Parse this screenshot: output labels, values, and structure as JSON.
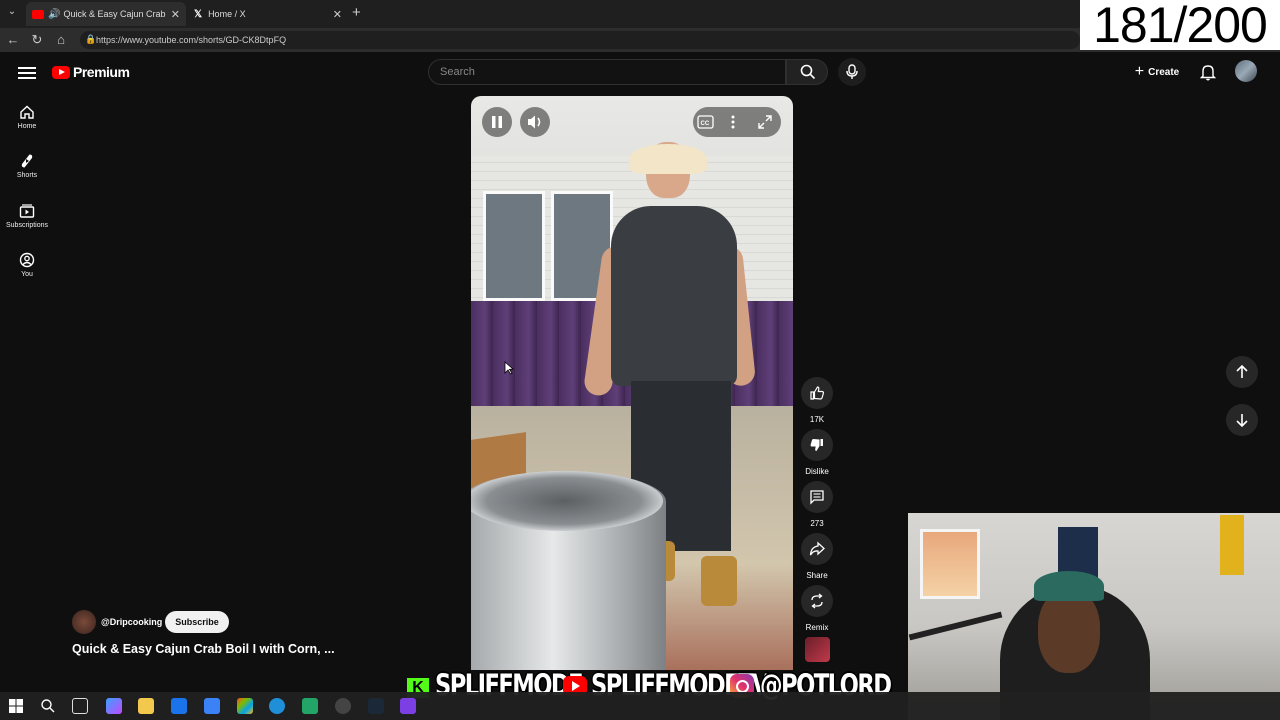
{
  "browser": {
    "tabs": [
      {
        "title": "Quick & Easy Cajun Crab Boil",
        "active": true,
        "icon": "youtube-icon"
      },
      {
        "title": "Home / X",
        "active": false,
        "icon": "x-logo-icon"
      }
    ],
    "url": "https://www.youtube.com/shorts/GD-CK8DtpFQ"
  },
  "counter": "181/200",
  "header": {
    "logo_text": "Premium",
    "search_placeholder": "Search",
    "create_label": "Create"
  },
  "sidebar": {
    "items": [
      {
        "label": "Home",
        "icon": "home-icon"
      },
      {
        "label": "Shorts",
        "icon": "shorts-icon"
      },
      {
        "label": "Subscriptions",
        "icon": "subscriptions-icon"
      },
      {
        "label": "You",
        "icon": "you-icon"
      }
    ]
  },
  "actions": {
    "like_count": "17K",
    "dislike_label": "Dislike",
    "comment_count": "273",
    "share_label": "Share",
    "remix_label": "Remix"
  },
  "channel": {
    "handle": "@Dripcooking",
    "subscribe_label": "Subscribe"
  },
  "video": {
    "title": "Quick & Easy Cajun Crab Boil I with Corn, ..."
  },
  "overlay": {
    "kick_letter": "K",
    "kick_name": "SPLIFFMODE",
    "youtube_name": "SPLIFFMODETV",
    "instagram_name": "@POTLORD"
  },
  "colors": {
    "background": "#0f0f0f",
    "youtube_red": "#ff0000",
    "kick_green": "#53fc18"
  }
}
